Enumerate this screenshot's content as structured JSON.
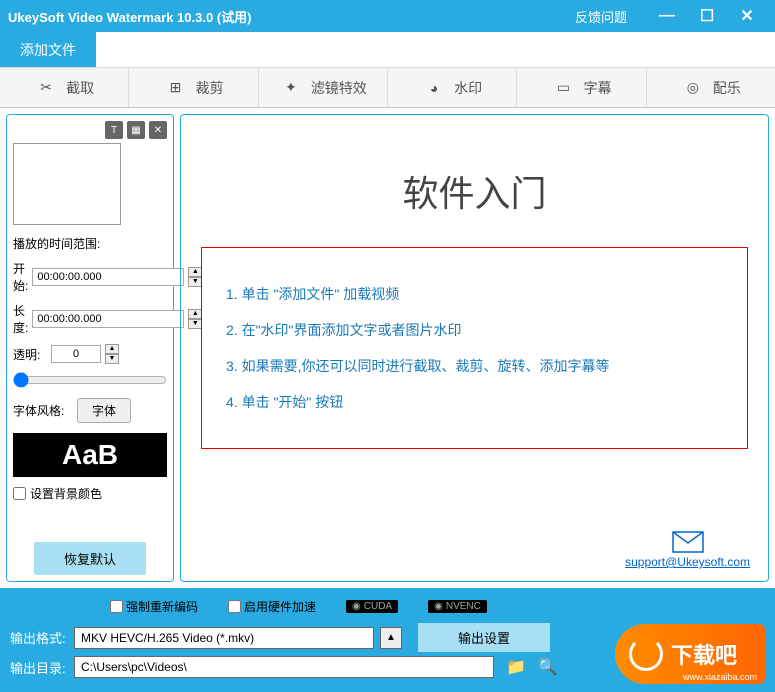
{
  "titlebar": {
    "title": "UkeySoft Video Watermark 10.3.0 (试用)",
    "feedback": "反馈问题"
  },
  "tabs": {
    "add_file": "添加文件"
  },
  "toolbar": {
    "capture": "截取",
    "crop": "裁剪",
    "filter": "滤镜特效",
    "watermark": "水印",
    "subtitle": "字幕",
    "music": "配乐"
  },
  "left": {
    "range_label": "播放的时间范围:",
    "start_label": "开始:",
    "start_value": "00:00:00.000",
    "length_label": "长度:",
    "length_value": "00:00:00.000",
    "opacity_label": "透明:",
    "opacity_value": "0",
    "fontstyle_label": "字体风格:",
    "font_button": "字体",
    "font_sample": "AaB",
    "bgcolor_label": "设置背景颜色",
    "reset": "恢复默认"
  },
  "guide": {
    "title": "软件入门",
    "steps": [
      "1. 单击 \"添加文件\" 加载视频",
      "2. 在\"水印\"界面添加文字或者图片水印",
      "3. 如果需要,你还可以同时进行截取、裁剪、旋转、添加字幕等",
      "4. 单击 \"开始\" 按钮"
    ],
    "support": "support@Ukeysoft.com"
  },
  "bottom": {
    "force_encode": "强制重新编码",
    "hw_accel": "启用硬件加速",
    "cuda": "CUDA",
    "nvenc": "NVENC",
    "out_format_label": "输出格式:",
    "out_format_value": "MKV HEVC/H.265 Video (*.mkv)",
    "out_settings": "输出设置",
    "out_dir_label": "输出目录:",
    "out_dir_value": "C:\\Users\\pc\\Videos\\"
  },
  "logo": {
    "text": "下载吧",
    "sub": "www.xiazaiba.com"
  }
}
